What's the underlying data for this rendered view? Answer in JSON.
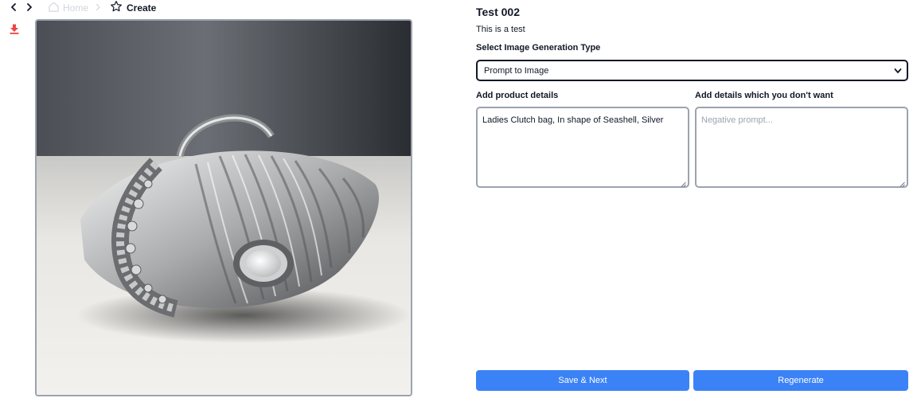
{
  "nav": {
    "back_icon": "chevron-left-icon",
    "forward_icon": "chevron-right-icon",
    "home_label": "Home",
    "current_label": "Create",
    "current_icon": "star-outline-icon"
  },
  "toolbar": {
    "download_icon": "download-icon",
    "download_color": "#ef4444"
  },
  "image": {
    "subject": "product-photo-silver-seashell-clutch-bag"
  },
  "form": {
    "title": "Test 002",
    "description": "This is a test",
    "generation_type_label": "Select Image Generation Type",
    "generation_type_value": "Prompt to Image",
    "product_details_label": "Add product details",
    "product_details_value": "Ladies Clutch bag, In shape of Seashell, Silver",
    "negative_label": "Add details which you don't want",
    "negative_placeholder": "Negative prompt..."
  },
  "actions": {
    "save_next_label": "Save & Next",
    "regenerate_label": "Regenerate",
    "accent_color": "#3b82f6"
  }
}
